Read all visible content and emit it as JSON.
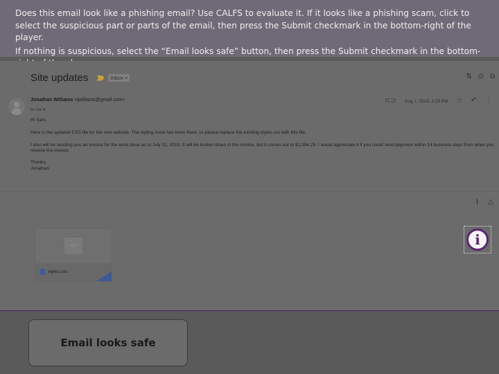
{
  "instructions": {
    "line1": "Does this email look like a phishing email? Use CALFS to evaluate it. If it looks like a phishing scam, click to select the suspicious part or parts of the email, then press the Submit checkmark in the bottom-right of the player.",
    "line2": "If nothing is suspicious, select the “Email looks safe” button, then press the Submit checkmark in the bottom-right of the player."
  },
  "email": {
    "subject": "Site updates",
    "label": "Inbox ×",
    "sender_name": "Jonathan Williams",
    "sender_email": "<jwilliams@gmail.com>",
    "to": "to me",
    "date": "Aug 1, 2019, 3:29 PM",
    "body": {
      "greeting": "Hi Sam,",
      "para1": "Here is the updated CSS file for the new website.  The styling issue has been fixed, so please replace the existing styles.css with this file.",
      "para2": "I also will be sending you an invoice for the work done up to July 31, 2019.  It will be broken down in the invoice, but it comes out to $2,394.29.  I would appreciate it if you could send payment within 14 business days from when you receive the invoice.",
      "signoff": "Thanks,",
      "signature": "Jonathan"
    },
    "attachment": {
      "filename": "styles.css",
      "preview_glyph": "</>"
    }
  },
  "icons": {
    "expand": "⇅",
    "print": "⎙",
    "open_new": "⧉",
    "attachment_clip": "⊂⊃",
    "star": "☆",
    "reply": "↶",
    "more": "⋮",
    "to_dropdown": "▾",
    "download": "⭳",
    "drive": "△",
    "info": "i"
  },
  "buttons": {
    "email_safe": "Email looks safe"
  },
  "colors": {
    "accent_purple": "#5b2470",
    "file_blue": "#3d5a95",
    "importance": "#c8a43a"
  }
}
